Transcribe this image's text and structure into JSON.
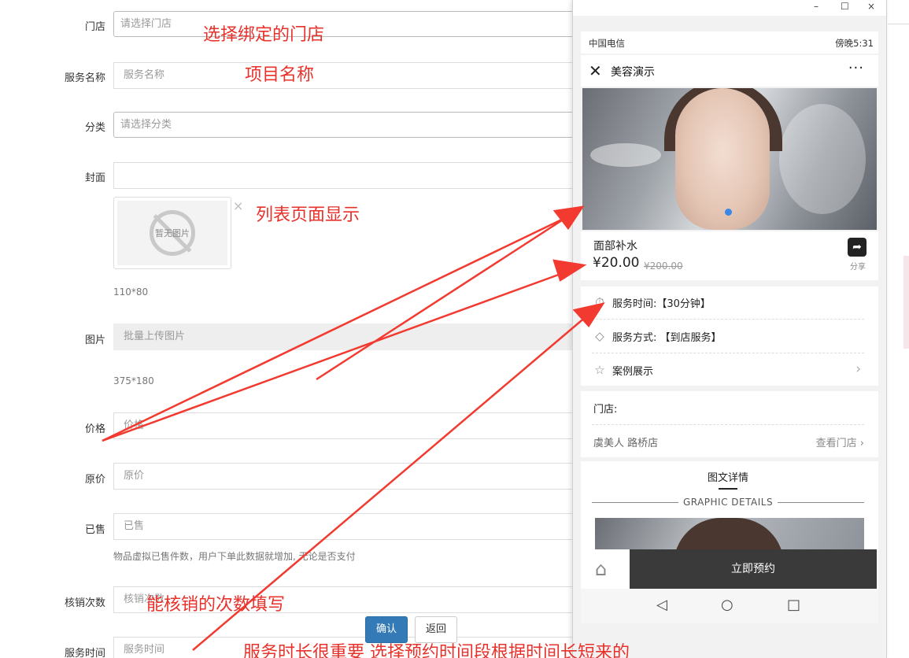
{
  "form": {
    "store_label": "门店",
    "store_placeholder": "请选择门店",
    "service_name_label": "服务名称",
    "service_name_placeholder": "服务名称",
    "category_label": "分类",
    "category_placeholder": "请选择分类",
    "cover_label": "封面",
    "cover_no_image": "暂无图片",
    "cover_close": "×",
    "cover_size": "110*80",
    "images_label": "图片",
    "images_button": "批量上传图片",
    "images_size": "375*180",
    "price_label": "价格",
    "price_placeholder": "价格",
    "original_price_label": "原价",
    "original_price_placeholder": "原价",
    "sold_label": "已售",
    "sold_placeholder": "已售",
    "sold_hint": "物品虚拟已售件数，用户下单此数据就增加, 无论是否支付",
    "verify_times_label": "核销次数",
    "verify_times_placeholder": "核销次数",
    "service_time_label": "服务时间",
    "service_time_placeholder": "服务时间",
    "confirm_button": "确认",
    "back_button": "返回"
  },
  "annotations": {
    "store": "选择绑定的门店",
    "project_name": "项目名称",
    "list_display": "列表页面显示",
    "verify": "能核销的次数填写",
    "service_time": "服务时长很重要  选择预约时间段根据时间长短来的"
  },
  "window": {
    "minimize": "–",
    "maximize": "☐",
    "close": "×"
  },
  "phone": {
    "carrier": "中国电信",
    "status_right": "傍晚5:31",
    "nav_title": "美容演示",
    "nav_close": "✕",
    "nav_more": "···",
    "product_name": "面部补水",
    "price": "¥20.00",
    "original_price": "¥200.00",
    "share_label": "分享",
    "service_time": "服务时间:【30分钟】",
    "service_mode": "服务方式: 【到店服务】",
    "case_show": "案例展示",
    "store_heading": "门店:",
    "store_name": "虞美人 路桥店",
    "view_store": "查看门店",
    "detail_title": "图文详情",
    "detail_subtitle": "GRAPHIC DETAILS",
    "book_button": "立即预约"
  },
  "colors": {
    "annotation": "#e8312a",
    "primary": "#337ab7",
    "booking_bar": "#3a3a3a",
    "banner_dot": "#3b87e8"
  }
}
